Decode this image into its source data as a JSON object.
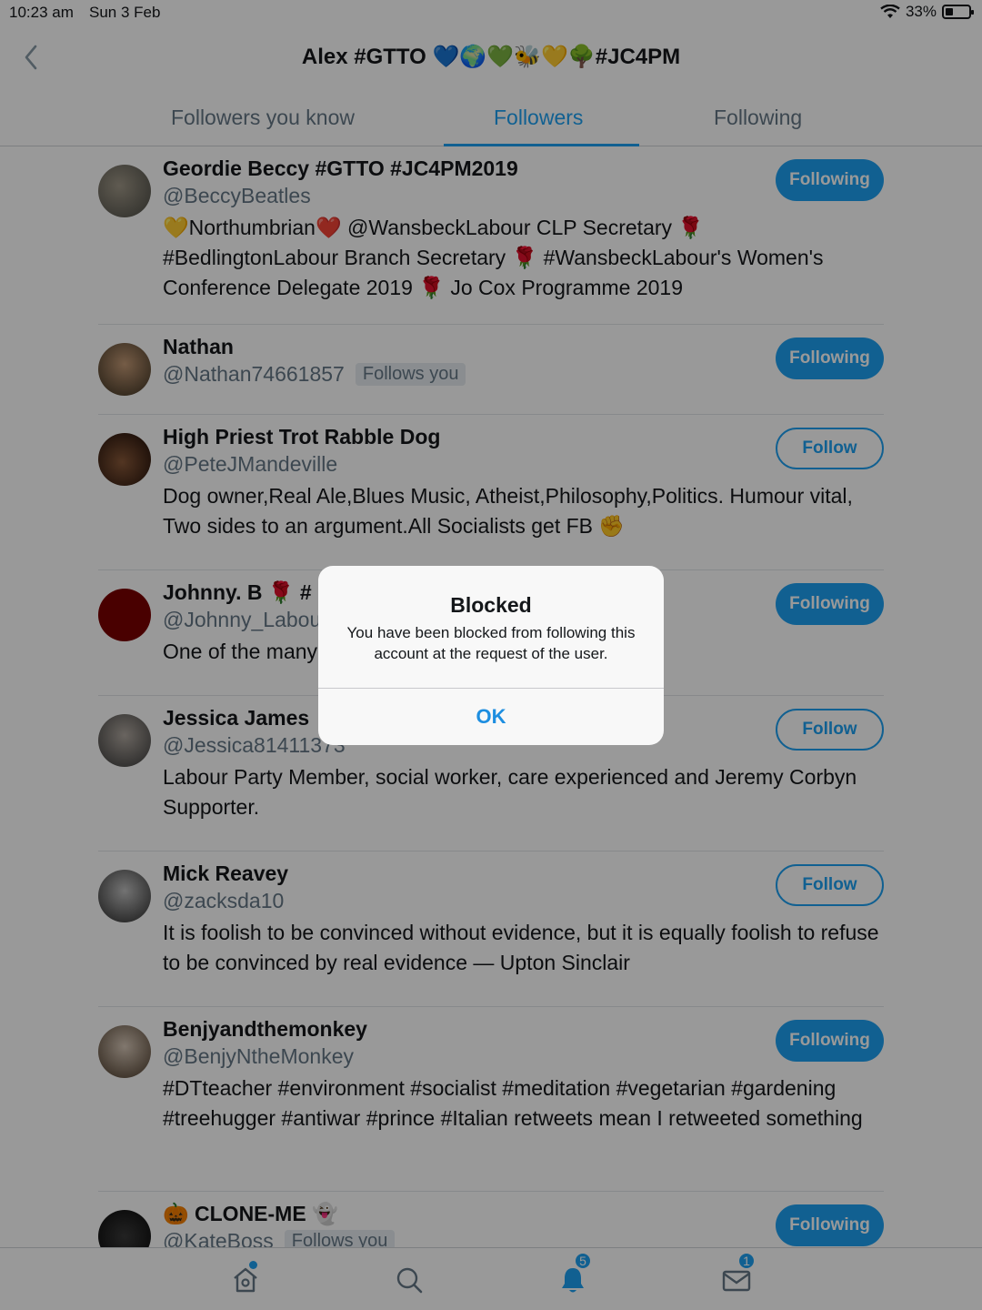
{
  "status_bar": {
    "time": "10:23 am",
    "date": "Sun 3 Feb",
    "battery": "33%",
    "battery_level": 0.33
  },
  "header": {
    "back_icon": "chevron-left-icon",
    "title": "Alex #GTTO 💙🌍💚🐝💛🌳#JC4PM"
  },
  "tabs": [
    {
      "label": "Followers you know",
      "active": false
    },
    {
      "label": "Followers",
      "active": true
    },
    {
      "label": "Following",
      "active": false
    }
  ],
  "followers": [
    {
      "name": "Geordie Beccy #GTTO #JC4PM2019",
      "handle": "@BeccyBeatles",
      "follows_you": "",
      "bio": "💛Northumbrian❤️ @WansbeckLabour CLP Secretary 🌹 #BedlingtonLabour Branch Secretary 🌹 #WansbeckLabour's Women's Conference Delegate 2019 🌹 Jo Cox Programme 2019",
      "button": "Following",
      "avatar_color": "#7a7a72"
    },
    {
      "name": "Nathan",
      "handle": "@Nathan74661857",
      "follows_you": "Follows you",
      "bio": "",
      "button": "Following",
      "avatar_color": "#8b6a4a"
    },
    {
      "name": "High Priest Trot Rabble Dog",
      "handle": "@PeteJMandeville",
      "follows_you": "",
      "bio": "Dog owner,Real Ale,Blues Music, Atheist,Philosophy,Politics. Humour vital, Two sides to an argument.All Socialists get FB ✊",
      "button": "Follow",
      "avatar_color": "#4a2a1a"
    },
    {
      "name": "Johnny. B 🌹 #",
      "handle": "@Johnny_Labou",
      "follows_you": "",
      "bio": "One of the many",
      "button": "Following",
      "avatar_color": "#8b0000"
    },
    {
      "name": "Jessica James",
      "handle": "@Jessica81411373",
      "follows_you": "",
      "bio": "Labour Party Member, social worker, care experienced and Jeremy Corbyn Supporter.",
      "button": "Follow",
      "avatar_color": "#6a6a6a"
    },
    {
      "name": "Mick Reavey",
      "handle": "@zacksda10",
      "follows_you": "",
      "bio": "It is foolish to be convinced without evidence, but it is equally foolish to refuse to be convinced by real evidence — Upton Sinclair",
      "button": "Follow",
      "avatar_color": "#5a5a5a"
    },
    {
      "name": "Benjyandthemonkey",
      "handle": "@BenjyNtheMonkey",
      "follows_you": "",
      "bio": "#DTteacher #environment #socialist #meditation #vegetarian #gardening #treehugger #antiwar #prince #Italian retweets mean I retweeted something",
      "button": "Following",
      "avatar_color": "#8a7a6a"
    },
    {
      "name": "🎃 CLONE-ME 👻",
      "handle": "@KateBoss",
      "follows_you": "Follows you",
      "bio": "",
      "button": "Following",
      "avatar_color": "#1a1a1a"
    }
  ],
  "tab_bar": {
    "home_icon": "home-icon",
    "search_icon": "search-icon",
    "notifications_icon": "bell-icon",
    "notifications_count": "5",
    "messages_icon": "mail-icon",
    "messages_count": "1"
  },
  "alert": {
    "title": "Blocked",
    "message": "You have been blocked from following this account at the request of the user.",
    "ok_label": "OK"
  },
  "colors": {
    "accent": "#1da1f2",
    "secondary_text": "#657786"
  }
}
